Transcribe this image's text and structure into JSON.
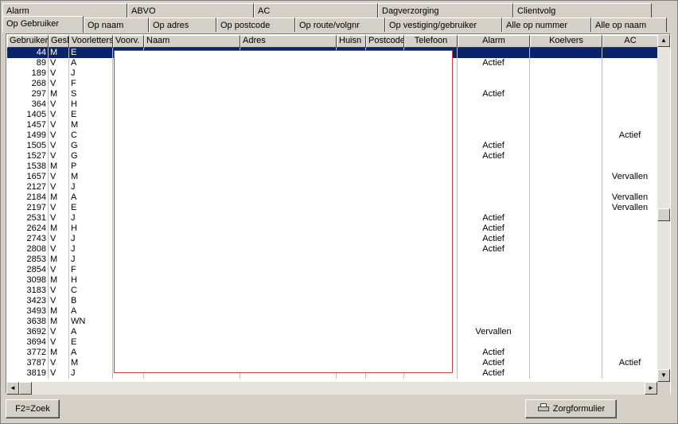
{
  "tabs_row1": [
    {
      "label": "Alarm",
      "w": 157
    },
    {
      "label": "ABVO",
      "w": 159
    },
    {
      "label": "AC",
      "w": 156
    },
    {
      "label": "Dagverzorging",
      "w": 170
    },
    {
      "label": "Clientvolg",
      "w": 174
    }
  ],
  "tabs_row2": [
    {
      "label": "Op Gebruiker",
      "w": 102,
      "active": true
    },
    {
      "label": "Op naam",
      "w": 82
    },
    {
      "label": "Op  adres",
      "w": 85
    },
    {
      "label": "Op postcode",
      "w": 99
    },
    {
      "label": "Op route/volgnr",
      "w": 113
    },
    {
      "label": "Op vestiging/gebruiker",
      "w": 147
    },
    {
      "label": "Alle op nummer",
      "w": 112
    },
    {
      "label": "Alle op naam",
      "w": 95
    }
  ],
  "columns": [
    "Gebruiker",
    "Gesl",
    "Voorletters",
    "Voorv.",
    "Naam",
    "Adres",
    "Huisn",
    "Postcode",
    "Telefoon",
    "Alarm",
    "Koelvers",
    "AC"
  ],
  "rows": [
    {
      "id": "44",
      "g": "M",
      "v": "E",
      "alarm": "",
      "ac": "",
      "selected": true
    },
    {
      "id": "89",
      "g": "V",
      "v": "A",
      "alarm": "Actief",
      "ac": ""
    },
    {
      "id": "189",
      "g": "V",
      "v": "J",
      "alarm": "",
      "ac": ""
    },
    {
      "id": "268",
      "g": "V",
      "v": "F",
      "alarm": "",
      "ac": ""
    },
    {
      "id": "297",
      "g": "M",
      "v": "S",
      "alarm": "Actief",
      "ac": ""
    },
    {
      "id": "364",
      "g": "V",
      "v": "H",
      "alarm": "",
      "ac": ""
    },
    {
      "id": "1405",
      "g": "V",
      "v": "E",
      "alarm": "",
      "ac": ""
    },
    {
      "id": "1457",
      "g": "V",
      "v": "M",
      "alarm": "",
      "ac": ""
    },
    {
      "id": "1499",
      "g": "V",
      "v": "C",
      "alarm": "",
      "ac": "Actief"
    },
    {
      "id": "1505",
      "g": "V",
      "v": "G",
      "alarm": "Actief",
      "ac": ""
    },
    {
      "id": "1527",
      "g": "V",
      "v": "G",
      "alarm": "Actief",
      "ac": ""
    },
    {
      "id": "1538",
      "g": "M",
      "v": "P",
      "alarm": "",
      "ac": ""
    },
    {
      "id": "1657",
      "g": "V",
      "v": "M",
      "alarm": "",
      "ac": "Vervallen"
    },
    {
      "id": "2127",
      "g": "V",
      "v": "J",
      "alarm": "",
      "ac": ""
    },
    {
      "id": "2184",
      "g": "M",
      "v": "A",
      "alarm": "",
      "ac": "Vervallen"
    },
    {
      "id": "2197",
      "g": "V",
      "v": "E",
      "alarm": "",
      "ac": "Vervallen"
    },
    {
      "id": "2531",
      "g": "V",
      "v": "J",
      "alarm": "Actief",
      "ac": ""
    },
    {
      "id": "2624",
      "g": "M",
      "v": "H",
      "alarm": "Actief",
      "ac": ""
    },
    {
      "id": "2743",
      "g": "V",
      "v": "J",
      "alarm": "Actief",
      "ac": ""
    },
    {
      "id": "2808",
      "g": "V",
      "v": "J",
      "alarm": "Actief",
      "ac": ""
    },
    {
      "id": "2853",
      "g": "M",
      "v": "J",
      "alarm": "",
      "ac": ""
    },
    {
      "id": "2854",
      "g": "V",
      "v": "F",
      "alarm": "",
      "ac": ""
    },
    {
      "id": "3098",
      "g": "M",
      "v": "H",
      "alarm": "",
      "ac": ""
    },
    {
      "id": "3183",
      "g": "V",
      "v": "C",
      "alarm": "",
      "ac": ""
    },
    {
      "id": "3423",
      "g": "V",
      "v": "B",
      "alarm": "",
      "ac": ""
    },
    {
      "id": "3493",
      "g": "M",
      "v": "A",
      "alarm": "",
      "ac": ""
    },
    {
      "id": "3638",
      "g": "M",
      "v": "WN",
      "alarm": "",
      "ac": ""
    },
    {
      "id": "3692",
      "g": "V",
      "v": "A",
      "alarm": "Vervallen",
      "ac": ""
    },
    {
      "id": "3694",
      "g": "V",
      "v": "E",
      "alarm": "",
      "ac": ""
    },
    {
      "id": "3772",
      "g": "M",
      "v": "A",
      "alarm": "Actief",
      "ac": ""
    },
    {
      "id": "3787",
      "g": "V",
      "v": "M",
      "alarm": "Actief",
      "ac": "Actief"
    },
    {
      "id": "3819",
      "g": "V",
      "v": "J",
      "alarm": "Actief",
      "ac": ""
    }
  ],
  "buttons": {
    "zoek": "F2=Zoek",
    "zorgformulier": "Zorgformulier"
  },
  "icons": {
    "scroll_up": "▲",
    "scroll_down": "▼",
    "scroll_left": "◄",
    "scroll_right": "►",
    "printer": "printer-icon"
  },
  "colors": {
    "selection": "#0a246a",
    "overlay_border": "#c04040"
  }
}
